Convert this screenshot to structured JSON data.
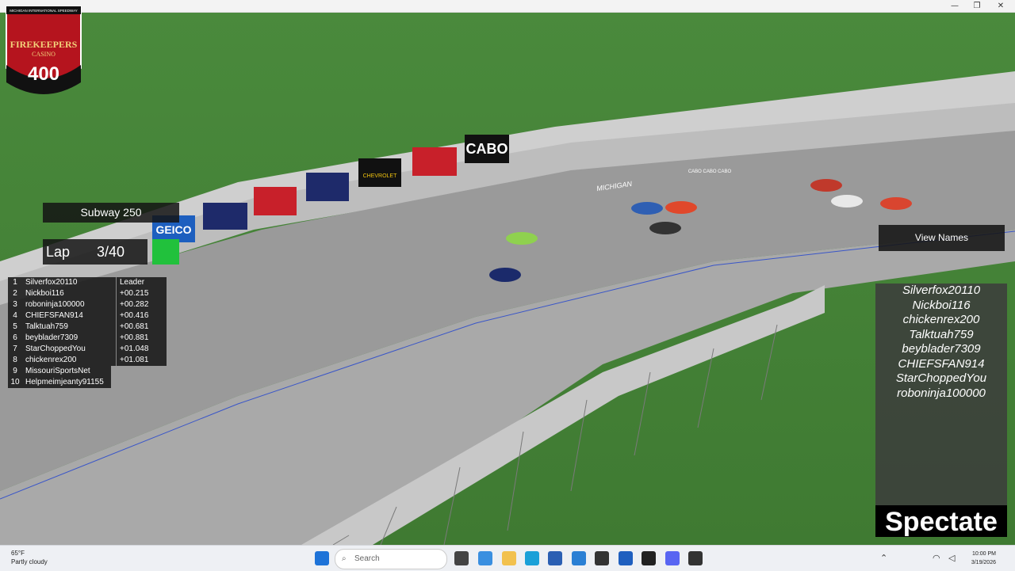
{
  "window": {
    "minimize": "—",
    "maximize": "❐",
    "close": "✕"
  },
  "logo": {
    "top_text": "MICHIGAN INTERNATIONAL SPEEDWAY",
    "line1": "FIREKEEPERS",
    "line2": "CASINO",
    "number": "400"
  },
  "race": {
    "name": "Subway 250"
  },
  "lap": {
    "label": "Lap",
    "value": "3/40"
  },
  "leaderboard": [
    {
      "pos": "1",
      "name": "Silverfox20110",
      "gap": "Leader"
    },
    {
      "pos": "2",
      "name": "Nickboi116",
      "gap": "+00.215"
    },
    {
      "pos": "3",
      "name": "roboninja100000",
      "gap": "+00.282"
    },
    {
      "pos": "4",
      "name": "CHIEFSFAN914",
      "gap": "+00.416"
    },
    {
      "pos": "5",
      "name": "Talktuah759",
      "gap": "+00.681"
    },
    {
      "pos": "6",
      "name": "beyblader7309",
      "gap": "+00.881"
    },
    {
      "pos": "7",
      "name": "StarChoppedYou",
      "gap": "+01.048"
    },
    {
      "pos": "8",
      "name": "chickenrex200",
      "gap": "+01.081"
    },
    {
      "pos": "9",
      "name": "MissouriSportsNet",
      "gap": ""
    },
    {
      "pos": "10",
      "name": "Helpmeimjeanty91155",
      "gap": ""
    }
  ],
  "view_names_button": "View Names",
  "names_panel": [
    "Silverfox20110",
    "Nickboi116",
    "chickenrex200",
    "Talktuah759",
    "beyblader7309",
    "CHIEFSFAN914",
    "StarChoppedYou",
    "roboninja100000"
  ],
  "spectate_label": "Spectate",
  "track_signs": {
    "cabo": "CABO",
    "geico": "GEICO",
    "michigan": "MICHIGAN",
    "chevrolet": "CHEVROLET",
    "cabo_strip": "CABO CABO CABO"
  },
  "taskbar": {
    "weather_temp": "65°F",
    "weather_desc": "Partly cloudy",
    "search_placeholder": "Search",
    "time": "10:00 PM",
    "date": "3/19/2026"
  },
  "colors": {
    "grass": "#4f8a3c",
    "track": "#9c9c9c",
    "wall": "#d8d8d8",
    "flag_green": "#21c13c"
  }
}
